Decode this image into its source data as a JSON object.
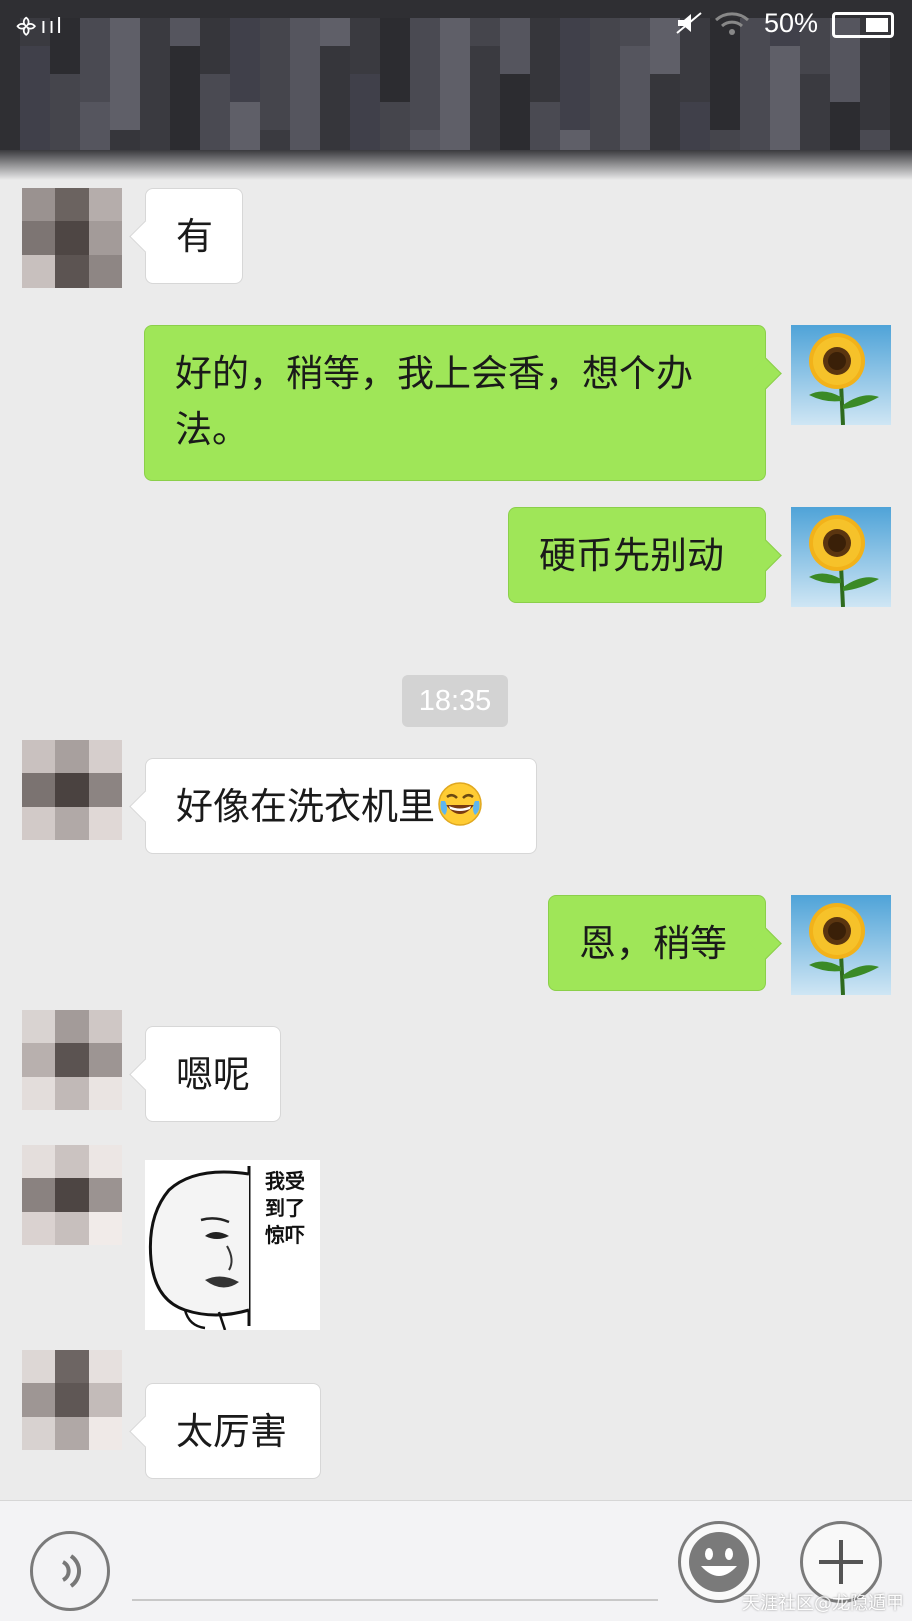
{
  "status_bar": {
    "battery_percent": "50%"
  },
  "messages": [
    {
      "id": "m1",
      "direction": "in",
      "text": "有"
    },
    {
      "id": "m2",
      "direction": "out",
      "text": "好的，稍等，我上会香，想个办法。"
    },
    {
      "id": "m3",
      "direction": "out",
      "text": "硬币先别动"
    },
    {
      "id": "m4",
      "direction": "timestamp",
      "text": "18:35"
    },
    {
      "id": "m5",
      "direction": "in",
      "text": "好像在洗衣机里",
      "emoji": "tears-of-joy-emoji"
    },
    {
      "id": "m6",
      "direction": "out",
      "text": "恩，稍等"
    },
    {
      "id": "m7",
      "direction": "in",
      "text": "嗯呢"
    },
    {
      "id": "m8",
      "direction": "in",
      "type": "sticker",
      "sticker_text": "我受到了惊吓"
    },
    {
      "id": "m9",
      "direction": "in",
      "text": "太厉害"
    }
  ],
  "input_bar": {
    "voice_icon": "voice-icon",
    "emoji_icon": "smiley-icon",
    "plus_icon": "plus-icon"
  },
  "watermark": "天涯社区@龙隐遁甲",
  "colors": {
    "outgoing_bubble": "#9fe658",
    "incoming_bubble": "#ffffff",
    "chat_background": "#ebebeb",
    "top_bar": "#2f2f33"
  }
}
